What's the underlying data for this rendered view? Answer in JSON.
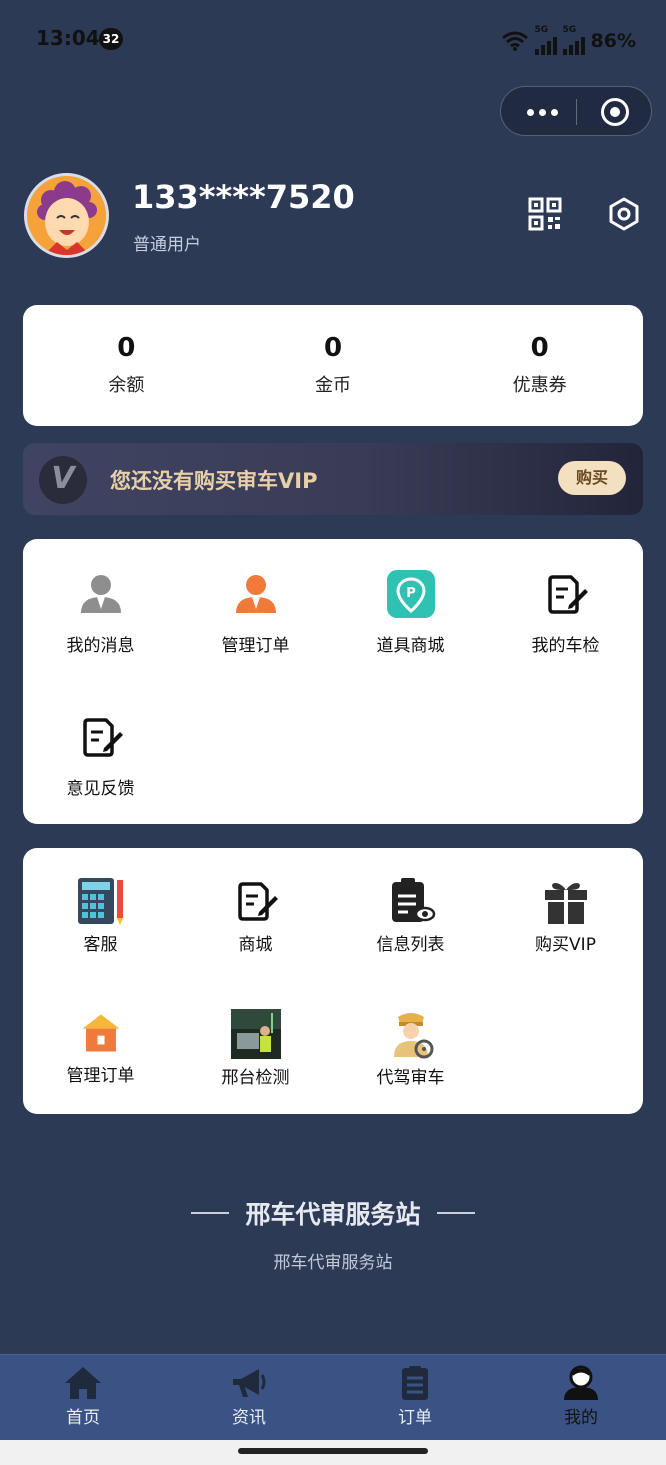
{
  "status_bar": {
    "time": "13:04",
    "badge": "32",
    "network1": "5G",
    "network2": "5G",
    "battery": "86%"
  },
  "profile": {
    "phone": "133****7520",
    "user_type": "普通用户"
  },
  "stats": [
    {
      "value": "0",
      "label": "余额"
    },
    {
      "value": "0",
      "label": "金币"
    },
    {
      "value": "0",
      "label": "优惠券"
    }
  ],
  "vip_banner": {
    "logo": "V",
    "text": "您还没有购买审车VIP",
    "button": "购买"
  },
  "services": [
    {
      "label": "我的消息",
      "icon": "user-message-icon"
    },
    {
      "label": "管理订单",
      "icon": "manager-user-icon"
    },
    {
      "label": "道具商城",
      "icon": "map-pin-p-icon"
    },
    {
      "label": "我的车检",
      "icon": "edit-document-icon"
    },
    {
      "label": "意见反馈",
      "icon": "edit-document-icon"
    }
  ],
  "tools": [
    {
      "label": "客服",
      "icon": "calculator-icon"
    },
    {
      "label": "商城",
      "icon": "edit-document-icon"
    },
    {
      "label": "信息列表",
      "icon": "clipboard-eye-icon"
    },
    {
      "label": "购买VIP",
      "icon": "gift-icon"
    },
    {
      "label": "管理订单",
      "icon": "house-icon"
    },
    {
      "label": "邢台检测",
      "icon": "photo-thumbnail"
    },
    {
      "label": "代驾审车",
      "icon": "driver-avatar-icon"
    }
  ],
  "footer": {
    "title": "邢车代审服务站",
    "subtitle": "邢车代审服务站"
  },
  "tabbar": [
    {
      "label": "首页",
      "icon": "home-icon"
    },
    {
      "label": "资讯",
      "icon": "megaphone-icon"
    },
    {
      "label": "订单",
      "icon": "clipboard-list-icon"
    },
    {
      "label": "我的",
      "icon": "user-profile-icon"
    }
  ],
  "colors": {
    "background": "#2d3a56",
    "tabbar": "#3b5384",
    "vip_gold": "#e8cfa8",
    "teal": "#2fc2b2",
    "orange": "#f07a3a"
  }
}
